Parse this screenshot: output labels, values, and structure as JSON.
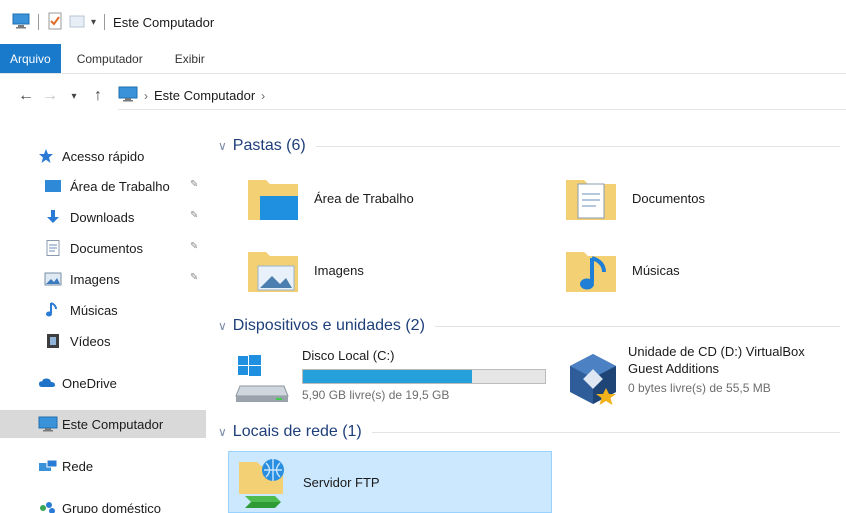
{
  "window": {
    "title": "Este Computador"
  },
  "ribbon": {
    "tabs": [
      "Arquivo",
      "Computador",
      "Exibir"
    ]
  },
  "address": {
    "location": "Este Computador"
  },
  "sidebar": {
    "quick_access": "Acesso rápido",
    "items": [
      {
        "label": "Área de Trabalho",
        "icon": "desktop-icon",
        "pinned": true
      },
      {
        "label": "Downloads",
        "icon": "download-arrow-icon",
        "pinned": true
      },
      {
        "label": "Documentos",
        "icon": "document-icon",
        "pinned": true
      },
      {
        "label": "Imagens",
        "icon": "picture-icon",
        "pinned": true
      },
      {
        "label": "Músicas",
        "icon": "music-note-icon",
        "pinned": false
      },
      {
        "label": "Vídeos",
        "icon": "film-icon",
        "pinned": false
      }
    ],
    "onedrive": "OneDrive",
    "this_pc": "Este Computador",
    "network": "Rede",
    "homegroup": "Grupo doméstico"
  },
  "groups": {
    "folders": {
      "header": "Pastas (6)",
      "items": [
        "Área de Trabalho",
        "Documentos",
        "Imagens",
        "Músicas"
      ]
    },
    "devices": {
      "header": "Dispositivos e unidades (2)",
      "local_disk": {
        "name": "Disco Local (C:)",
        "free_text": "5,90 GB livre(s) de 19,5 GB",
        "used_fraction": 0.7
      },
      "cd": {
        "name_line1": "Unidade de CD (D:) VirtualBox",
        "name_line2": "Guest Additions",
        "free_text": "0 bytes livre(s) de 55,5 MB"
      }
    },
    "network": {
      "header": "Locais de rede (1)",
      "items": [
        "Servidor FTP"
      ]
    }
  },
  "colors": {
    "accent": "#1979ca",
    "selection": "#cce8ff",
    "progress": "#26a0da",
    "group_text": "#1e3f7a"
  }
}
